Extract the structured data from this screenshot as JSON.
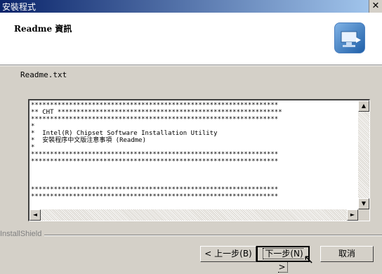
{
  "window": {
    "title": "安裝程式",
    "close_glyph": "✕"
  },
  "header": {
    "title": "Readme 資訊"
  },
  "file_label": "Readme.txt",
  "readme_text": "*****************************************************************\n** CHT ***********************************************************\n*****************************************************************\n*\n*  Intel(R) Chipset Software Installation Utility\n*  安裝程序中文版注意事項 (Readme)\n*\n*****************************************************************\n*****************************************************************\n\n\n\n*****************************************************************\n*****************************************************************",
  "brand": "InstallShield",
  "buttons": {
    "back": "< 上一步(B)",
    "next": "下一步(N) >",
    "cancel": "取消"
  },
  "scroll": {
    "up": "▲",
    "down": "▼",
    "left": "◄",
    "right": "►"
  },
  "cursor_glyph": "↖"
}
